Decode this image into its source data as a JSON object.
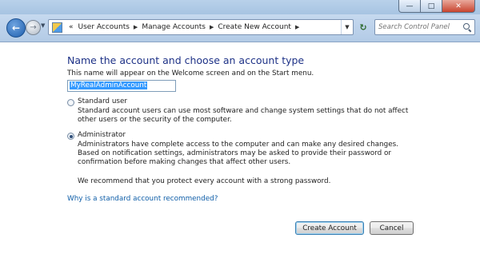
{
  "window": {
    "caption_buttons": [
      "minimize",
      "maximize",
      "close"
    ]
  },
  "navbar": {
    "breadcrumb_overflow": "«",
    "breadcrumbs": [
      "User Accounts",
      "Manage Accounts",
      "Create New Account"
    ],
    "search_placeholder": "Search Control Panel"
  },
  "form": {
    "heading": "Name the account and choose an account type",
    "hint": "This name will appear on the Welcome screen and on the Start menu.",
    "account_name": "MyRealAdminAccount",
    "options": [
      {
        "label": "Standard user",
        "description": "Standard account users can use most software and change system settings that do not affect other users or the security of the computer.",
        "selected": false
      },
      {
        "label": "Administrator",
        "description": "Administrators have complete access to the computer and can make any desired changes. Based on notification settings, administrators may be asked to provide their password or confirmation before making changes that affect other users.",
        "selected": true
      }
    ],
    "recommendation": "We recommend that you protect every account with a strong password.",
    "help_link": "Why is a standard account recommended?"
  },
  "buttons": {
    "create": "Create Account",
    "cancel": "Cancel"
  },
  "colors": {
    "heading": "#1e3287",
    "link": "#0f5ea8",
    "selection": "#3399ff"
  }
}
